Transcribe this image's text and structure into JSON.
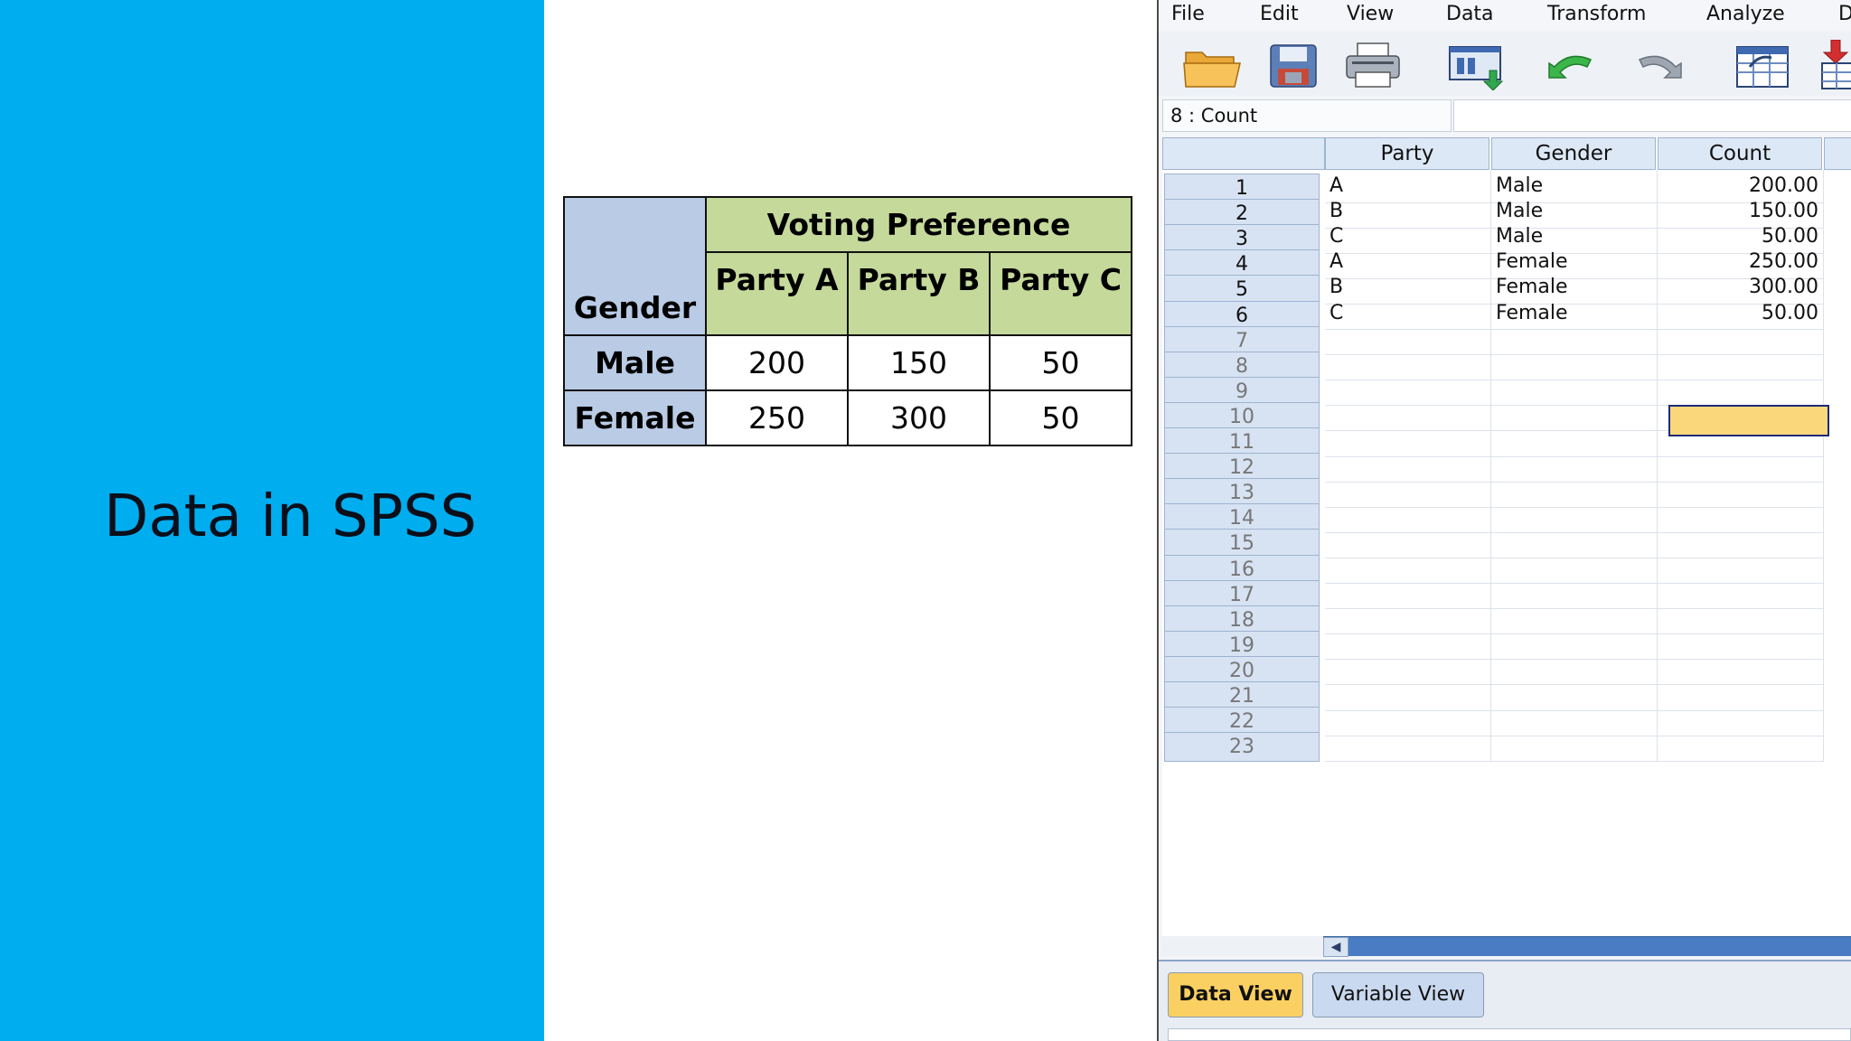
{
  "slide": {
    "title": "Data in SPSS",
    "panel_color": "#00adef"
  },
  "crosstab": {
    "row_header_label": "Gender",
    "group_label": "Voting Preference",
    "columns": [
      "Party A",
      "Party B",
      "Party C"
    ],
    "rows": [
      {
        "label": "Male",
        "values": [
          "200",
          "150",
          "50"
        ]
      },
      {
        "label": "Female",
        "values": [
          "250",
          "300",
          "50"
        ]
      }
    ],
    "colors": {
      "header_blue": "#b9cbe5",
      "header_green": "#c5d99b"
    }
  },
  "spss": {
    "menu": [
      "File",
      "Edit",
      "View",
      "Data",
      "Transform",
      "Analyze",
      "D"
    ],
    "toolbar_icons": [
      "open-folder-icon",
      "save-icon",
      "print-icon",
      "dialog-recall-icon",
      "undo-icon",
      "redo-icon",
      "goto-case-icon",
      "insert-variable-icon"
    ],
    "cell_reference": "8 : Count",
    "cell_value": "",
    "columns": [
      "Party",
      "Gender",
      "Count"
    ],
    "rows": [
      [
        "A",
        "Male",
        "200.00"
      ],
      [
        "B",
        "Male",
        "150.00"
      ],
      [
        "C",
        "Male",
        "50.00"
      ],
      [
        "A",
        "Female",
        "250.00"
      ],
      [
        "B",
        "Female",
        "300.00"
      ],
      [
        "C",
        "Female",
        "50.00"
      ]
    ],
    "row_numbers": [
      "1",
      "2",
      "3",
      "4",
      "5",
      "6",
      "7",
      "8",
      "9",
      "10",
      "11",
      "12",
      "13",
      "14",
      "15",
      "16",
      "17",
      "18",
      "19",
      "20",
      "21",
      "22",
      "23"
    ],
    "selected_row": "8",
    "selected_column": "Count",
    "tabs": {
      "data_view": "Data View",
      "variable_view": "Variable View"
    },
    "colors": {
      "selected_cell": "#fbd77c",
      "active_tab": "#fbd062"
    }
  }
}
